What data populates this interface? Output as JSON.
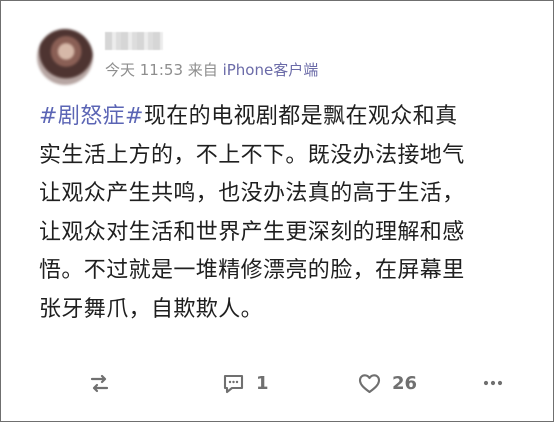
{
  "post": {
    "timestamp": "今天 11:53",
    "source_prefix": "来自",
    "source": "iPhone客户端",
    "hashtag": "#剧怒症#",
    "lines": {
      "line1_rest": "现在的电视剧都是飘在观众和真",
      "line2": "实生活上方的，不上不下。既没办法接地气",
      "line3": "让观众产生共鸣，也没办法真的高于生活，",
      "line4": "让观众对生活和世界产生更深刻的理解和感",
      "line5": "悟。不过就是一堆精修漂亮的脸，在屏幕里",
      "line6": "张牙舞爪，自欺欺人。"
    }
  },
  "actions": {
    "comment_count": "1",
    "like_count": "26"
  },
  "icons": {
    "repost": "repost-icon",
    "comment": "comment-icon",
    "like": "heart-icon",
    "more": "more-icon"
  },
  "colors": {
    "hashtag": "#5b65b5",
    "meta_source": "#6b6ba8",
    "text": "#1f1f1f",
    "icon": "#707070"
  }
}
